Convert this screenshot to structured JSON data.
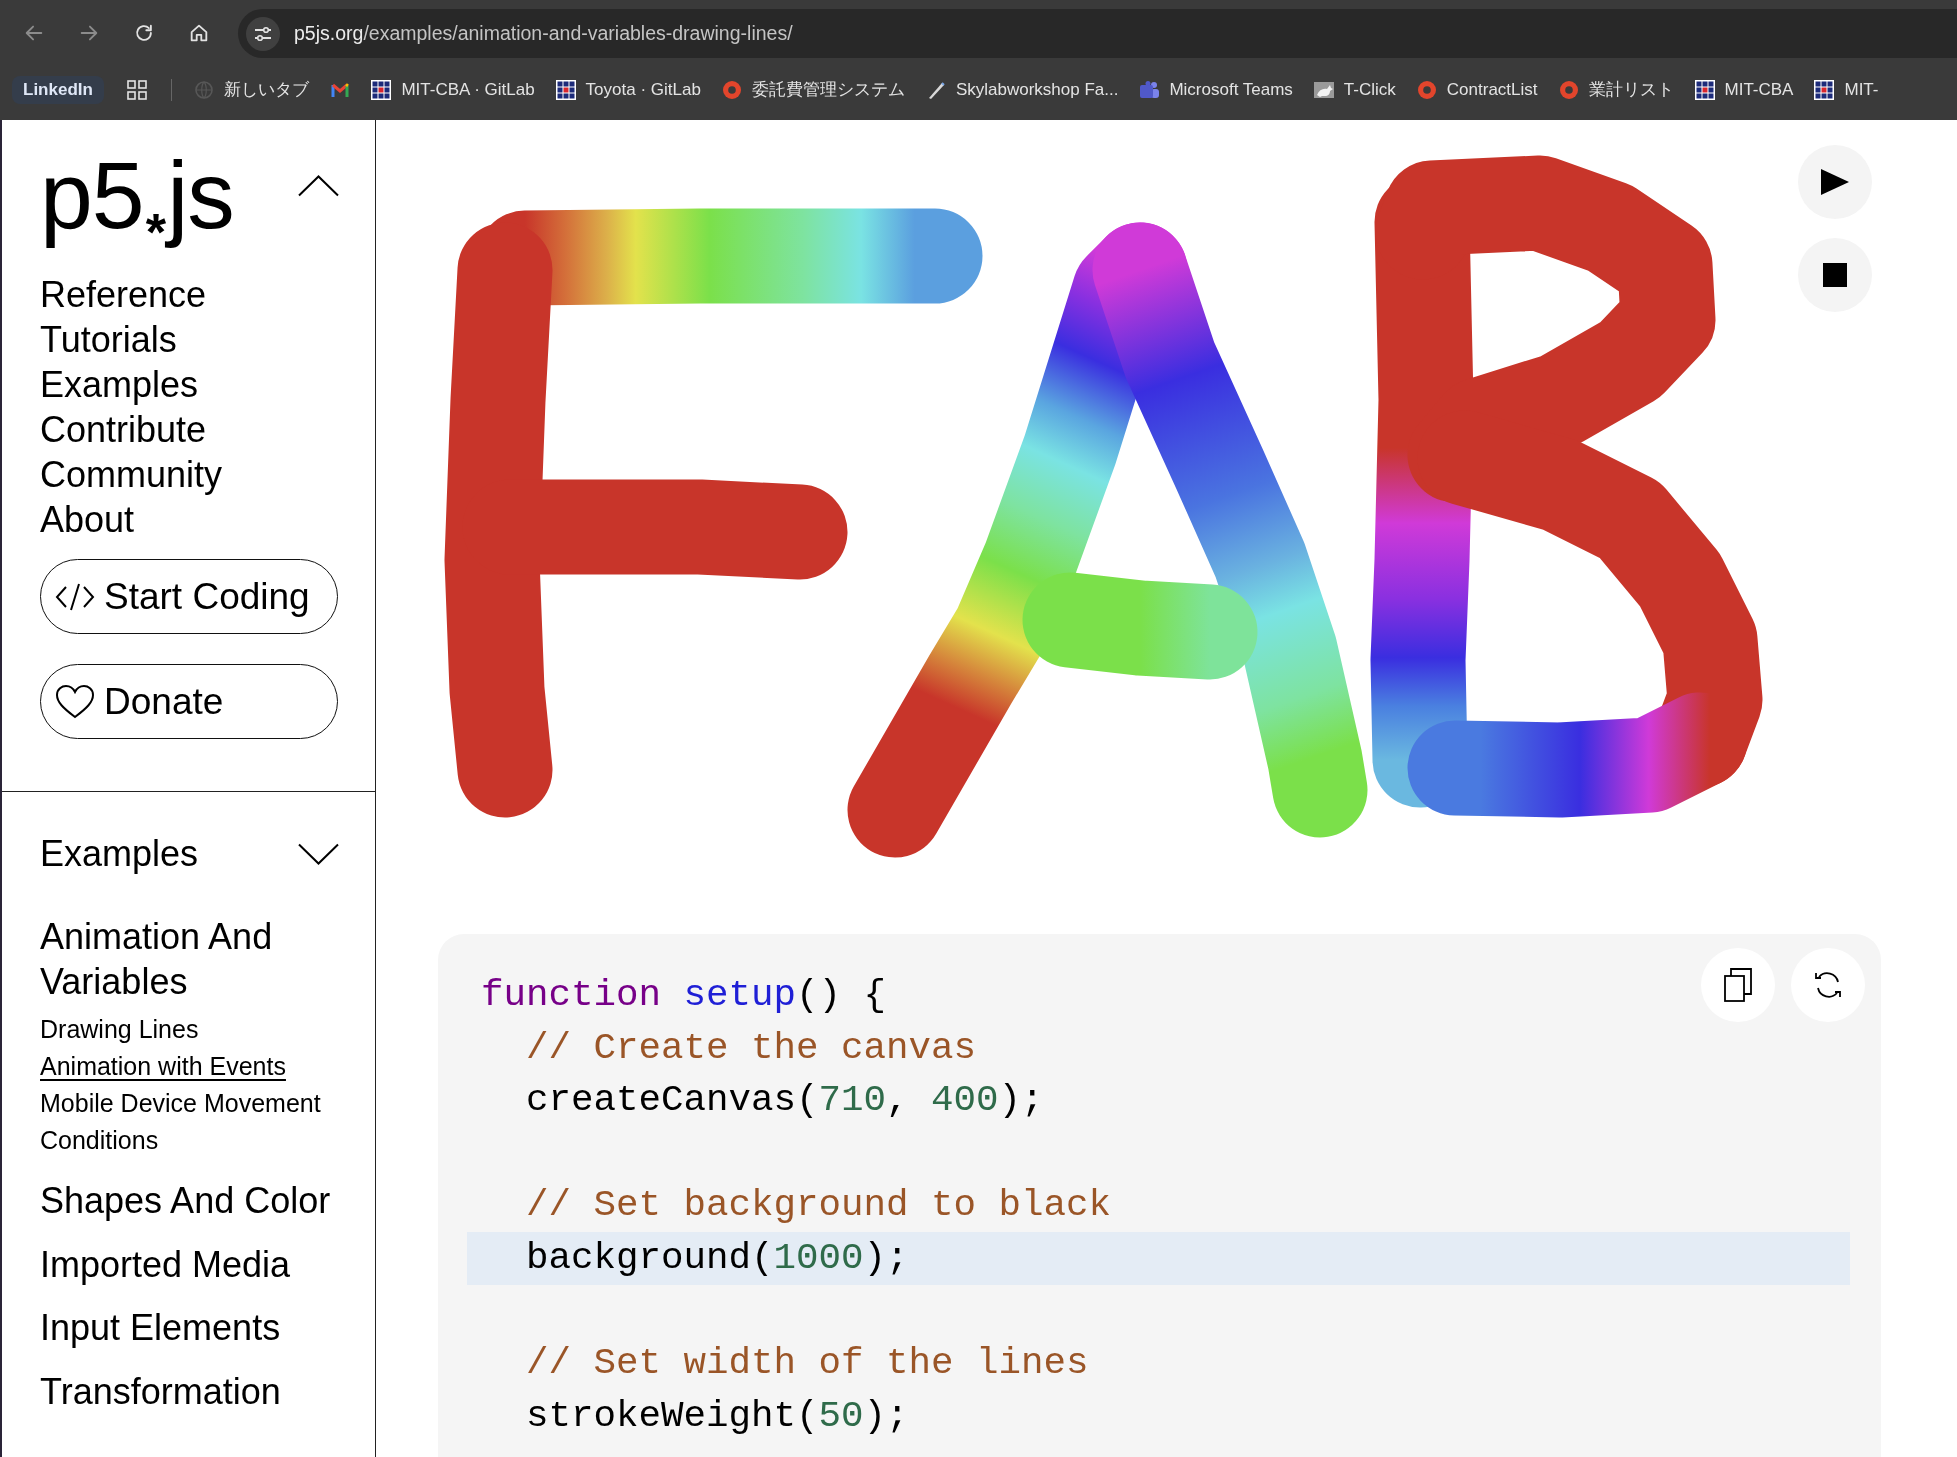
{
  "browser": {
    "navigation": [
      {
        "kind": "back",
        "disabled": true
      },
      {
        "kind": "forward",
        "disabled": true
      },
      {
        "kind": "reload",
        "disabled": false
      },
      {
        "kind": "home",
        "disabled": false
      }
    ],
    "url": {
      "host": "p5js.org",
      "path": "/examples/animation-and-variables-drawing-lines/"
    }
  },
  "bookmarks": {
    "pinned": "LinkedIn",
    "items": [
      {
        "label": "新しいタブ",
        "kind": "globe"
      },
      {
        "kind": "mail"
      },
      {
        "label": "MIT-CBA · GitLab",
        "kind": "grid"
      },
      {
        "label": "Toyota · GitLab",
        "kind": "grid"
      },
      {
        "label": "委託費管理システム",
        "kind": "ring"
      },
      {
        "label": "Skylabworkshop Fa...",
        "kind": "pen"
      },
      {
        "label": "Microsoft Teams",
        "kind": "team"
      },
      {
        "label": "T-Click",
        "kind": "animal"
      },
      {
        "label": "ContractList",
        "kind": "ring"
      },
      {
        "label": "業計リスト",
        "kind": "ring"
      },
      {
        "label": "MIT-CBA",
        "kind": "grid"
      },
      {
        "label": "MIT-",
        "kind": "grid"
      }
    ]
  },
  "sidebar": {
    "logo": "p5$_{*}$js",
    "menu": [
      "Reference",
      "Tutorials",
      "Examples",
      "Contribute",
      "Community",
      "About"
    ],
    "buttons": [
      {
        "kind": "code",
        "label": "Start Coding"
      },
      {
        "kind": "heart",
        "label": "Donate"
      }
    ],
    "examples": {
      "title": "Examples",
      "categories": [
        {
          "label": "Animation And Variables",
          "children": [
            {
              "label": "Drawing Lines",
              "hovered": false
            },
            {
              "label": "Animation with Events",
              "hovered": true
            },
            {
              "label": "Mobile Device Movement",
              "hovered": false
            },
            {
              "label": "Conditions",
              "hovered": false
            }
          ]
        },
        {
          "label": "Shapes And Color"
        },
        {
          "label": "Imported Media"
        },
        {
          "label": "Input Elements"
        },
        {
          "label": "Transformation"
        }
      ]
    }
  },
  "code": {
    "lines": [
      {
        "kind": "code",
        "highlighted": false,
        "tokens": [
          {
            "text": "function ",
            "kind": "keyword"
          },
          {
            "text": "setup",
            "kind": "def"
          },
          {
            "text": "() {",
            "kind": "plain"
          }
        ],
        "children": [
          {
            "kind": "code",
            "highlighted": false,
            "tokens": [
              {
                "text": "// Create the canvas",
                "kind": "comment"
              }
            ]
          },
          {
            "kind": "code",
            "highlighted": false,
            "tokens": [
              {
                "text": "createCanvas(",
                "kind": "plain"
              },
              {
                "text": "710",
                "kind": "number"
              },
              {
                "text": ", ",
                "kind": "plain"
              },
              {
                "text": "400",
                "kind": "number"
              },
              {
                "text": ");",
                "kind": "plain"
              }
            ]
          },
          {
            "kind": "blank",
            "highlighted": false
          },
          {
            "kind": "code",
            "highlighted": false,
            "tokens": [
              {
                "text": "// Set background to black",
                "kind": "comment"
              }
            ]
          },
          {
            "kind": "code",
            "highlighted": true,
            "tokens": [
              {
                "text": "background(",
                "kind": "plain"
              },
              {
                "text": "1000",
                "kind": "number"
              },
              {
                "text": ");",
                "kind": "plain"
              }
            ]
          },
          {
            "kind": "blank",
            "highlighted": false
          },
          {
            "kind": "code",
            "highlighted": false,
            "tokens": [
              {
                "text": "// Set width of the lines",
                "kind": "comment"
              }
            ]
          },
          {
            "kind": "code",
            "highlighted": false,
            "tokens": [
              {
                "text": "strokeWeight(",
                "kind": "plain"
              },
              {
                "text": "50",
                "kind": "number"
              },
              {
                "text": ");",
                "kind": "plain"
              }
            ]
          }
        ]
      }
    ]
  }
}
